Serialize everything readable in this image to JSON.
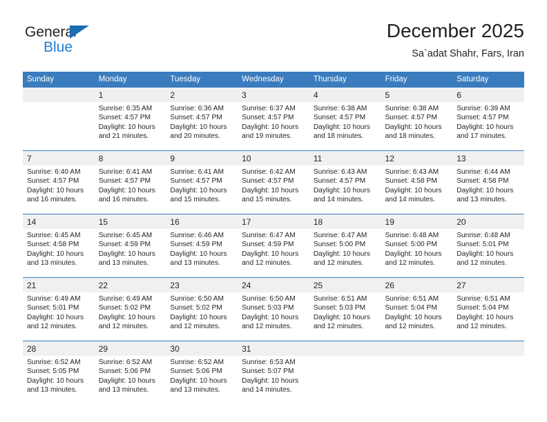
{
  "brand": {
    "name_part1": "General",
    "name_part2": "Blue",
    "logo_icon": "triangle-icon",
    "color_dark": "#231f20",
    "color_blue": "#1b7fd4",
    "color_triangle": "#1b6cb5"
  },
  "header": {
    "title": "December 2025",
    "subtitle": "Sa`adat Shahr, Fars, Iran"
  },
  "theme": {
    "header_bg": "#3a7cbe",
    "daynum_bg": "#f0f0f0",
    "text": "#231f20"
  },
  "weekday_headers": [
    "Sunday",
    "Monday",
    "Tuesday",
    "Wednesday",
    "Thursday",
    "Friday",
    "Saturday"
  ],
  "weeks": [
    [
      {
        "day": "",
        "sunrise": "",
        "sunset": "",
        "daylight_line1": "",
        "daylight_line2": ""
      },
      {
        "day": "1",
        "sunrise": "Sunrise: 6:35 AM",
        "sunset": "Sunset: 4:57 PM",
        "daylight_line1": "Daylight: 10 hours",
        "daylight_line2": "and 21 minutes."
      },
      {
        "day": "2",
        "sunrise": "Sunrise: 6:36 AM",
        "sunset": "Sunset: 4:57 PM",
        "daylight_line1": "Daylight: 10 hours",
        "daylight_line2": "and 20 minutes."
      },
      {
        "day": "3",
        "sunrise": "Sunrise: 6:37 AM",
        "sunset": "Sunset: 4:57 PM",
        "daylight_line1": "Daylight: 10 hours",
        "daylight_line2": "and 19 minutes."
      },
      {
        "day": "4",
        "sunrise": "Sunrise: 6:38 AM",
        "sunset": "Sunset: 4:57 PM",
        "daylight_line1": "Daylight: 10 hours",
        "daylight_line2": "and 18 minutes."
      },
      {
        "day": "5",
        "sunrise": "Sunrise: 6:38 AM",
        "sunset": "Sunset: 4:57 PM",
        "daylight_line1": "Daylight: 10 hours",
        "daylight_line2": "and 18 minutes."
      },
      {
        "day": "6",
        "sunrise": "Sunrise: 6:39 AM",
        "sunset": "Sunset: 4:57 PM",
        "daylight_line1": "Daylight: 10 hours",
        "daylight_line2": "and 17 minutes."
      }
    ],
    [
      {
        "day": "7",
        "sunrise": "Sunrise: 6:40 AM",
        "sunset": "Sunset: 4:57 PM",
        "daylight_line1": "Daylight: 10 hours",
        "daylight_line2": "and 16 minutes."
      },
      {
        "day": "8",
        "sunrise": "Sunrise: 6:41 AM",
        "sunset": "Sunset: 4:57 PM",
        "daylight_line1": "Daylight: 10 hours",
        "daylight_line2": "and 16 minutes."
      },
      {
        "day": "9",
        "sunrise": "Sunrise: 6:41 AM",
        "sunset": "Sunset: 4:57 PM",
        "daylight_line1": "Daylight: 10 hours",
        "daylight_line2": "and 15 minutes."
      },
      {
        "day": "10",
        "sunrise": "Sunrise: 6:42 AM",
        "sunset": "Sunset: 4:57 PM",
        "daylight_line1": "Daylight: 10 hours",
        "daylight_line2": "and 15 minutes."
      },
      {
        "day": "11",
        "sunrise": "Sunrise: 6:43 AM",
        "sunset": "Sunset: 4:57 PM",
        "daylight_line1": "Daylight: 10 hours",
        "daylight_line2": "and 14 minutes."
      },
      {
        "day": "12",
        "sunrise": "Sunrise: 6:43 AM",
        "sunset": "Sunset: 4:58 PM",
        "daylight_line1": "Daylight: 10 hours",
        "daylight_line2": "and 14 minutes."
      },
      {
        "day": "13",
        "sunrise": "Sunrise: 6:44 AM",
        "sunset": "Sunset: 4:58 PM",
        "daylight_line1": "Daylight: 10 hours",
        "daylight_line2": "and 13 minutes."
      }
    ],
    [
      {
        "day": "14",
        "sunrise": "Sunrise: 6:45 AM",
        "sunset": "Sunset: 4:58 PM",
        "daylight_line1": "Daylight: 10 hours",
        "daylight_line2": "and 13 minutes."
      },
      {
        "day": "15",
        "sunrise": "Sunrise: 6:45 AM",
        "sunset": "Sunset: 4:59 PM",
        "daylight_line1": "Daylight: 10 hours",
        "daylight_line2": "and 13 minutes."
      },
      {
        "day": "16",
        "sunrise": "Sunrise: 6:46 AM",
        "sunset": "Sunset: 4:59 PM",
        "daylight_line1": "Daylight: 10 hours",
        "daylight_line2": "and 13 minutes."
      },
      {
        "day": "17",
        "sunrise": "Sunrise: 6:47 AM",
        "sunset": "Sunset: 4:59 PM",
        "daylight_line1": "Daylight: 10 hours",
        "daylight_line2": "and 12 minutes."
      },
      {
        "day": "18",
        "sunrise": "Sunrise: 6:47 AM",
        "sunset": "Sunset: 5:00 PM",
        "daylight_line1": "Daylight: 10 hours",
        "daylight_line2": "and 12 minutes."
      },
      {
        "day": "19",
        "sunrise": "Sunrise: 6:48 AM",
        "sunset": "Sunset: 5:00 PM",
        "daylight_line1": "Daylight: 10 hours",
        "daylight_line2": "and 12 minutes."
      },
      {
        "day": "20",
        "sunrise": "Sunrise: 6:48 AM",
        "sunset": "Sunset: 5:01 PM",
        "daylight_line1": "Daylight: 10 hours",
        "daylight_line2": "and 12 minutes."
      }
    ],
    [
      {
        "day": "21",
        "sunrise": "Sunrise: 6:49 AM",
        "sunset": "Sunset: 5:01 PM",
        "daylight_line1": "Daylight: 10 hours",
        "daylight_line2": "and 12 minutes."
      },
      {
        "day": "22",
        "sunrise": "Sunrise: 6:49 AM",
        "sunset": "Sunset: 5:02 PM",
        "daylight_line1": "Daylight: 10 hours",
        "daylight_line2": "and 12 minutes."
      },
      {
        "day": "23",
        "sunrise": "Sunrise: 6:50 AM",
        "sunset": "Sunset: 5:02 PM",
        "daylight_line1": "Daylight: 10 hours",
        "daylight_line2": "and 12 minutes."
      },
      {
        "day": "24",
        "sunrise": "Sunrise: 6:50 AM",
        "sunset": "Sunset: 5:03 PM",
        "daylight_line1": "Daylight: 10 hours",
        "daylight_line2": "and 12 minutes."
      },
      {
        "day": "25",
        "sunrise": "Sunrise: 6:51 AM",
        "sunset": "Sunset: 5:03 PM",
        "daylight_line1": "Daylight: 10 hours",
        "daylight_line2": "and 12 minutes."
      },
      {
        "day": "26",
        "sunrise": "Sunrise: 6:51 AM",
        "sunset": "Sunset: 5:04 PM",
        "daylight_line1": "Daylight: 10 hours",
        "daylight_line2": "and 12 minutes."
      },
      {
        "day": "27",
        "sunrise": "Sunrise: 6:51 AM",
        "sunset": "Sunset: 5:04 PM",
        "daylight_line1": "Daylight: 10 hours",
        "daylight_line2": "and 12 minutes."
      }
    ],
    [
      {
        "day": "28",
        "sunrise": "Sunrise: 6:52 AM",
        "sunset": "Sunset: 5:05 PM",
        "daylight_line1": "Daylight: 10 hours",
        "daylight_line2": "and 13 minutes."
      },
      {
        "day": "29",
        "sunrise": "Sunrise: 6:52 AM",
        "sunset": "Sunset: 5:06 PM",
        "daylight_line1": "Daylight: 10 hours",
        "daylight_line2": "and 13 minutes."
      },
      {
        "day": "30",
        "sunrise": "Sunrise: 6:52 AM",
        "sunset": "Sunset: 5:06 PM",
        "daylight_line1": "Daylight: 10 hours",
        "daylight_line2": "and 13 minutes."
      },
      {
        "day": "31",
        "sunrise": "Sunrise: 6:53 AM",
        "sunset": "Sunset: 5:07 PM",
        "daylight_line1": "Daylight: 10 hours",
        "daylight_line2": "and 14 minutes."
      },
      {
        "day": "",
        "sunrise": "",
        "sunset": "",
        "daylight_line1": "",
        "daylight_line2": ""
      },
      {
        "day": "",
        "sunrise": "",
        "sunset": "",
        "daylight_line1": "",
        "daylight_line2": ""
      },
      {
        "day": "",
        "sunrise": "",
        "sunset": "",
        "daylight_line1": "",
        "daylight_line2": ""
      }
    ]
  ]
}
